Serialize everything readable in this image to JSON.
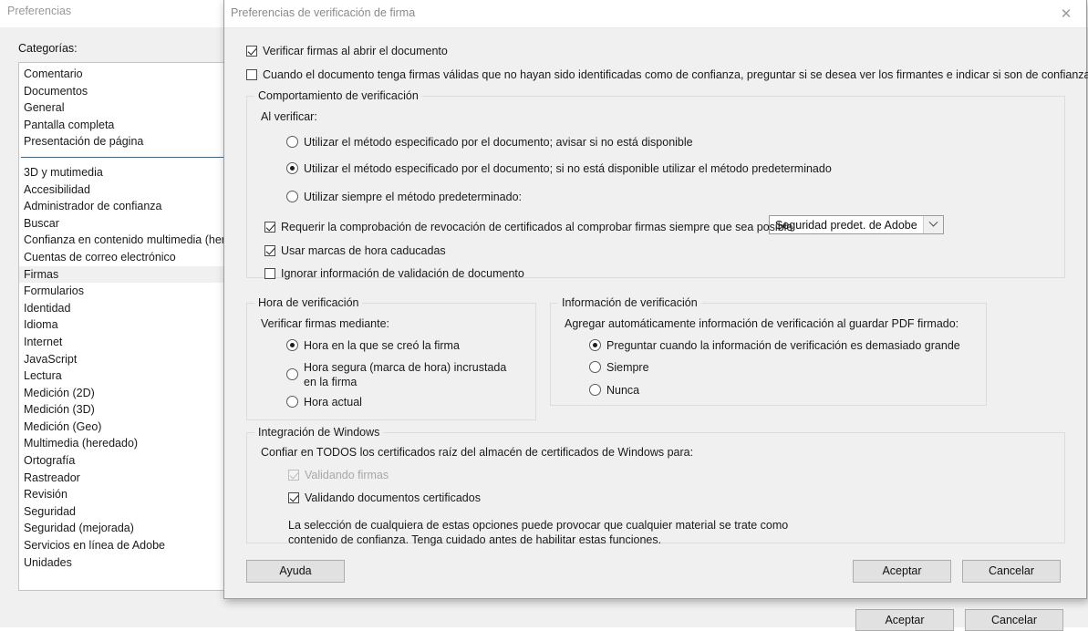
{
  "background_window": {
    "title": "Preferencias",
    "categories_label": "Categorías:",
    "categories_group1": [
      "Comentario",
      "Documentos",
      "General",
      "Pantalla completa",
      "Presentación de página"
    ],
    "categories_group2": [
      "3D y mutimedia",
      "Accesibilidad",
      "Administrador de confianza",
      "Buscar",
      "Confianza en contenido multimedia (here",
      "Cuentas de correo electrónico",
      "Firmas",
      "Formularios",
      "Identidad",
      "Idioma",
      "Internet",
      "JavaScript",
      "Lectura",
      "Medición (2D)",
      "Medición (3D)",
      "Medición (Geo)",
      "Multimedia (heredado)",
      "Ortografía",
      "Rastreador",
      "Revisión",
      "Seguridad",
      "Seguridad (mejorada)",
      "Servicios en línea de Adobe",
      "Unidades"
    ],
    "selected_category": "Firmas",
    "ok_label": "Aceptar",
    "cancel_label": "Cancelar",
    "separator_color": "#2b6ca3",
    "selection_color": "#f0f0f0"
  },
  "dialog": {
    "title": "Preferencias de verificación de firma",
    "close_icon": "close-icon",
    "top_checkboxes": [
      {
        "label": "Verificar firmas al abrir el documento",
        "checked": true
      },
      {
        "label": "Cuando el documento tenga firmas válidas que no hayan sido identificadas como de confianza, preguntar si se desea ver los firmantes e indicar si son de confianza",
        "checked": false
      }
    ],
    "verification_behavior": {
      "title": "Comportamiento de verificación",
      "sub_label": "Al verificar:",
      "radios": [
        {
          "label": "Utilizar el método especificado por el documento; avisar si no está disponible",
          "selected": false
        },
        {
          "label": "Utilizar el método especificado por el documento; si no está disponible utilizar el método predeterminado",
          "selected": true
        },
        {
          "label": "Utilizar siempre el método predeterminado:",
          "selected": false
        }
      ],
      "method_combo": {
        "value": "Seguridad predet. de Adobe",
        "chevron_icon": "chevron-down-icon"
      },
      "checkboxes": [
        {
          "label": "Requerir la comprobación de revocación de certificados al comprobar firmas siempre que sea posible",
          "checked": true
        },
        {
          "label": "Usar marcas de hora caducadas",
          "checked": true
        },
        {
          "label": "Ignorar información de validación de documento",
          "checked": false
        }
      ]
    },
    "verification_time": {
      "title": "Hora de verificación",
      "sub_label": "Verificar firmas mediante:",
      "radios": [
        {
          "label": "Hora en la que se creó la firma",
          "selected": true
        },
        {
          "label": "Hora segura (marca de hora) incrustada en la firma",
          "selected": false
        },
        {
          "label": "Hora actual",
          "selected": false
        }
      ]
    },
    "verification_info": {
      "title": "Información de verificación",
      "sub_label": "Agregar automáticamente información de verificación al guardar PDF firmado:",
      "radios": [
        {
          "label": "Preguntar cuando la información de verificación es demasiado grande",
          "selected": true
        },
        {
          "label": "Siempre",
          "selected": false
        },
        {
          "label": "Nunca",
          "selected": false
        }
      ]
    },
    "windows_integration": {
      "title": "Integración de Windows",
      "sub_label": "Confiar en TODOS los certificados raíz del almacén de certificados de Windows para:",
      "checkboxes": [
        {
          "label": "Validando firmas",
          "checked": true,
          "disabled": true
        },
        {
          "label": "Validando documentos certificados",
          "checked": true,
          "disabled": false
        }
      ],
      "note_line1": "La selección de cualquiera de estas opciones puede provocar que cualquier material se trate como",
      "note_line2": "contenido de confianza. Tenga cuidado antes de habilitar estas funciones."
    },
    "buttons": {
      "help": "Ayuda",
      "ok": "Aceptar",
      "cancel": "Cancelar"
    }
  }
}
